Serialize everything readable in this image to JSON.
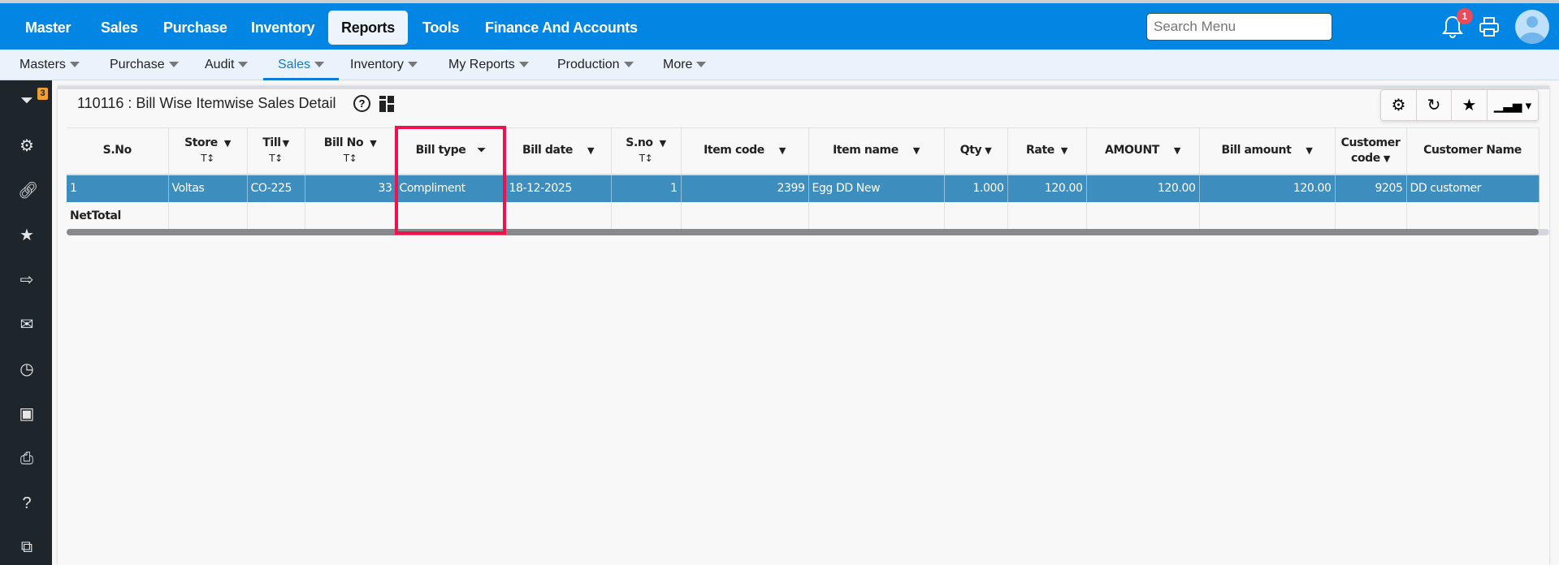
{
  "topnav": {
    "items": [
      "Master",
      "Sales",
      "Purchase",
      "Inventory",
      "Reports",
      "Tools",
      "Finance And Accounts"
    ],
    "active": "Reports"
  },
  "search": {
    "placeholder": "Search Menu"
  },
  "notifications": {
    "count": "1"
  },
  "subnav": {
    "items": [
      "Masters",
      "Purchase",
      "Audit",
      "Sales",
      "Inventory",
      "My Reports",
      "Production",
      "More"
    ],
    "active": "Sales"
  },
  "sidebar": {
    "filter_badge": "3",
    "icons": [
      "filter-icon",
      "gear-icon",
      "link-icon",
      "star-icon",
      "export-icon",
      "mail-icon",
      "clock-icon",
      "calendar-swap-icon",
      "print-icon",
      "help-icon",
      "external-link-icon"
    ]
  },
  "report": {
    "title": "110116 : Bill Wise Itemwise Sales Detail"
  },
  "table": {
    "columns": [
      "S.No",
      "Store",
      "Till",
      "Bill No",
      "Bill type",
      "Bill date",
      "S.no",
      "Item code",
      "Item name",
      "Qty",
      "Rate",
      "AMOUNT",
      "Bill amount",
      "Customer code",
      "Customer Name"
    ],
    "sort_hint": "T↕",
    "rows": [
      [
        "1",
        "Voltas",
        "CO-225",
        "33",
        "Compliment",
        "18-12-2025",
        "1",
        "2399",
        "Egg DD New",
        "1.000",
        "120.00",
        "120.00",
        "120.00",
        "9205",
        "DD customer"
      ]
    ],
    "total_label": "NetTotal"
  },
  "colors": {
    "brand": "#0385e3",
    "selected_row": "#3d8dbf",
    "highlight": "#f0124f"
  }
}
